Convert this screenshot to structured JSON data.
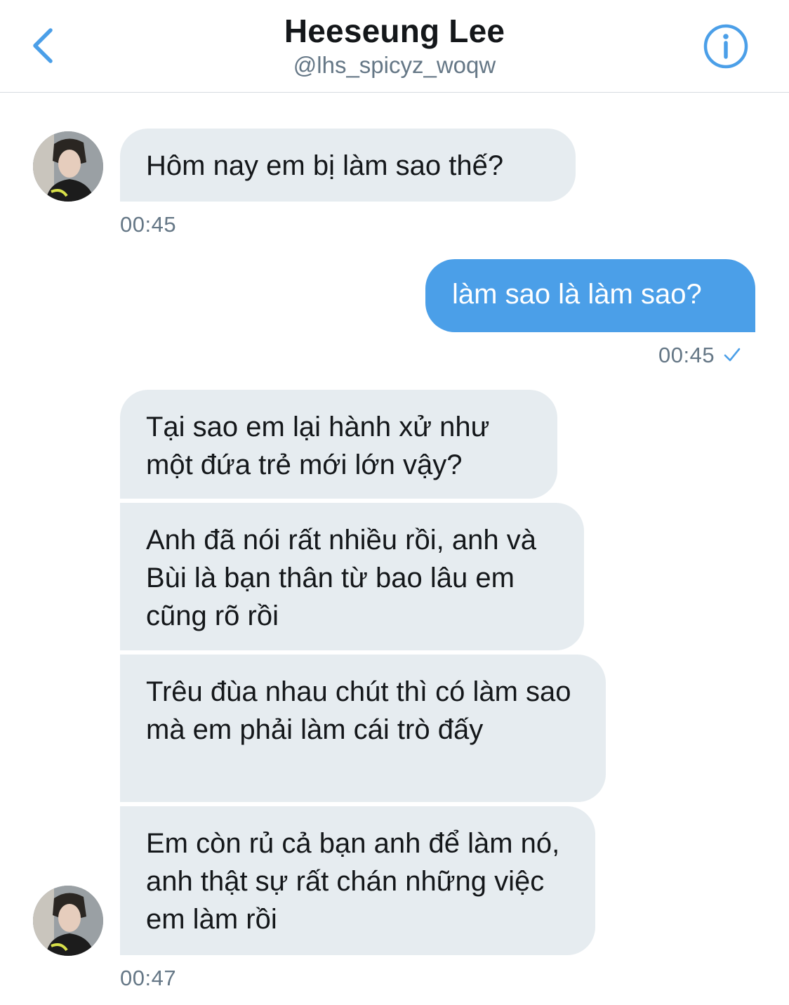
{
  "header": {
    "name": "Heeseung Lee",
    "handle": "@lhs_spicyz_woqw",
    "back_icon": "chevron-left-icon",
    "info_icon": "info-icon",
    "accent_color": "#4b9fe8"
  },
  "messages": [
    {
      "direction": "incoming",
      "text": "Hôm nay em bị làm sao thế?",
      "time": "00:45"
    },
    {
      "direction": "outgoing",
      "text": "làm sao là làm sao?",
      "time": "00:45",
      "status_icon": "checkmark-icon"
    },
    {
      "direction": "incoming",
      "text": "Tại sao em lại hành xử như một đứa trẻ mới lớn vậy?"
    },
    {
      "direction": "incoming",
      "text": "Anh đã nói rất nhiều rồi, anh và Bùi là bạn thân từ bao lâu em cũng rõ rồi"
    },
    {
      "direction": "incoming",
      "text": "Trêu đùa nhau chút thì có làm sao mà em phải làm cái trò đấy"
    },
    {
      "direction": "incoming",
      "text": "Em còn rủ cả bạn anh để làm nó, anh thật sự rất chán những việc em  làm rồi",
      "time": "00:47"
    }
  ],
  "colors": {
    "incoming_bubble": "#e6ecf0",
    "outgoing_bubble": "#4b9fe8",
    "timestamp": "#657786"
  }
}
